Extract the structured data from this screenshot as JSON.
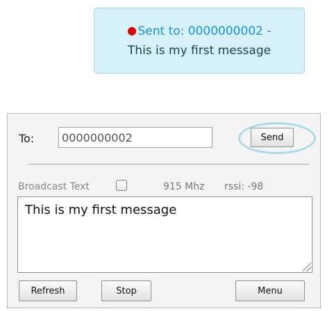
{
  "notification": {
    "sent_prefix": "Sent to: 0000000002 -",
    "message": "This is my first message",
    "status_color": "#e00000",
    "background_color": "#d7f1fb"
  },
  "form": {
    "to_label": "To:",
    "to_value": "0000000002",
    "send_label": "Send",
    "broadcast_label": "Broadcast Text",
    "broadcast_checked": false,
    "frequency": "915 Mhz",
    "rssi": "rssi: -98",
    "message_text": "This is my first message"
  },
  "buttons": {
    "refresh": "Refresh",
    "stop": "Stop",
    "menu": "Menu"
  }
}
